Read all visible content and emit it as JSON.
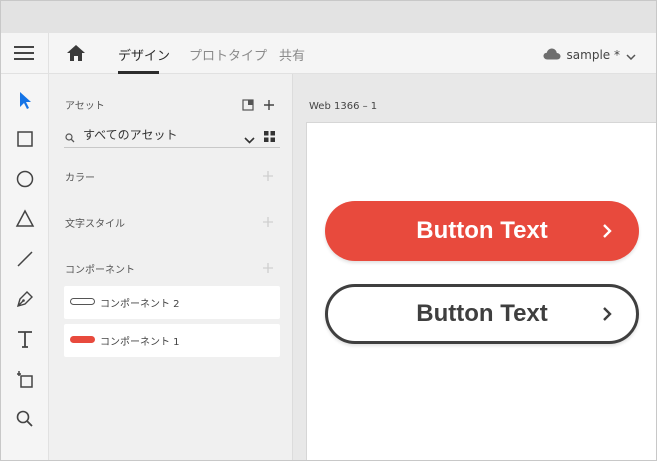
{
  "menubar": {
    "tabs": [
      {
        "label": "デザイン",
        "active": true
      },
      {
        "label": "プロトタイプ",
        "active": false
      },
      {
        "label": "共有",
        "active": false
      }
    ],
    "document_name": "sample *",
    "icons": {
      "menu": "hamburger-menu-icon",
      "home": "home-icon",
      "cloud": "cloud-icon",
      "dropdown": "chevron-down-icon"
    }
  },
  "toolbar": {
    "tools": [
      "select-tool",
      "rectangle-tool",
      "ellipse-tool",
      "polygon-tool",
      "line-tool",
      "pen-tool",
      "text-tool",
      "artboard-tool",
      "zoom-tool"
    ],
    "active_tool": "select-tool",
    "active_color": "#1473e6"
  },
  "assets": {
    "title": "アセット",
    "search_value": "すべてのアセット",
    "sections": {
      "colors": "カラー",
      "text_styles": "文字スタイル",
      "components": "コンポーネント"
    },
    "components": [
      {
        "label": "コンポーネント 2",
        "style": "outline"
      },
      {
        "label": "コンポーネント 1",
        "style": "filled"
      }
    ]
  },
  "canvas": {
    "artboard_name": "Web 1366 – 1",
    "buttons": [
      {
        "text": "Button Text",
        "style": "filled",
        "color": "#e84a3d",
        "text_color": "#ffffff"
      },
      {
        "text": "Button Text",
        "style": "outline",
        "color": "#3f3f3f",
        "text_color": "#3f3f3f"
      }
    ]
  }
}
